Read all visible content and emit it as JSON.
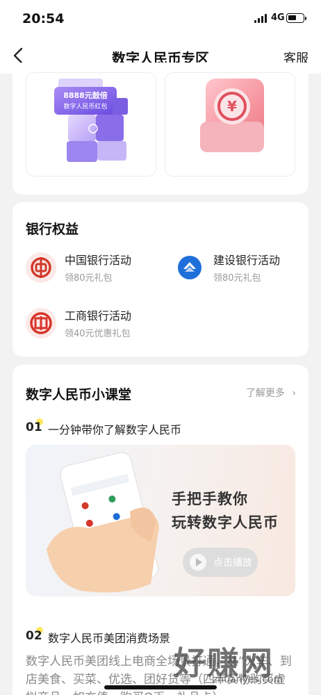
{
  "status_bar": {
    "time": "20:54",
    "network": "4G",
    "battery_level": 0.55
  },
  "nav": {
    "title": "数字人民币专区",
    "right_label": "客服"
  },
  "promo_tiles": [
    {
      "line1": "8888元鼓倍",
      "line2": "数字人民币红包"
    },
    {
      "line1": ""
    }
  ],
  "bank_section": {
    "title": "银行权益",
    "items": [
      {
        "name": "中国银行活动",
        "sub": "领80元礼包",
        "color": "#d23a2c"
      },
      {
        "name": "建设银行活动",
        "sub": "领80元礼包",
        "color": "#1e6fd9"
      },
      {
        "name": "工商银行活动",
        "sub": "领40元优惠礼包",
        "color": "#d8342a"
      }
    ]
  },
  "class_section": {
    "title": "数字人民币小课堂",
    "more_label": "了解更多",
    "lessons": [
      {
        "num": "01",
        "title": "一分钟带你了解数字人民币"
      },
      {
        "num": "02",
        "title": "数字人民币美团消费场景"
      }
    ],
    "banner": {
      "line1": "手把手教你",
      "line2": "玩转数字人民币",
      "play_label": "点击播放"
    },
    "paragraph": "数字人民币美团线上电商全场景打通，从“火车、到店美食、买菜、优选、团好货等（四半实物购买虚拟商品、如充值、购买Q币、礼品卡）"
  },
  "watermark": {
    "text": "好赚网",
    "url": "zhuanyes.com"
  }
}
